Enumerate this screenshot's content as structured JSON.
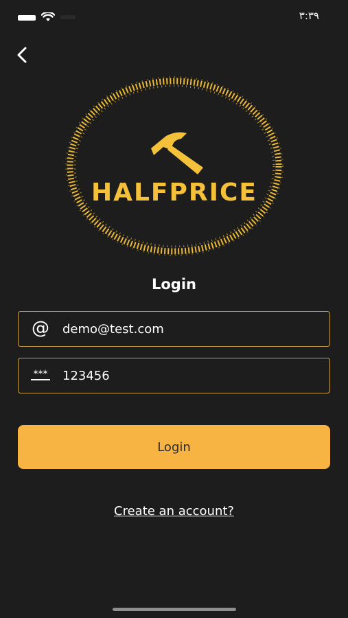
{
  "status_bar": {
    "time": "٣:٣٩"
  },
  "icons": {
    "back": "chevron-left-icon",
    "email": "at-icon",
    "password": "password-dots-icon",
    "logo": "hammer-icon"
  },
  "logo": {
    "brand_name": "HALFPRICE"
  },
  "login": {
    "title": "Login",
    "email_value": "demo@test.com",
    "password_value": "123456",
    "button_label": "Login",
    "create_account_label": "Create an account?"
  },
  "colors": {
    "background": "#1d1d1d",
    "accent": "#f8b443",
    "field_border": "#c8a044",
    "logo_gold": "#f5c13a"
  }
}
